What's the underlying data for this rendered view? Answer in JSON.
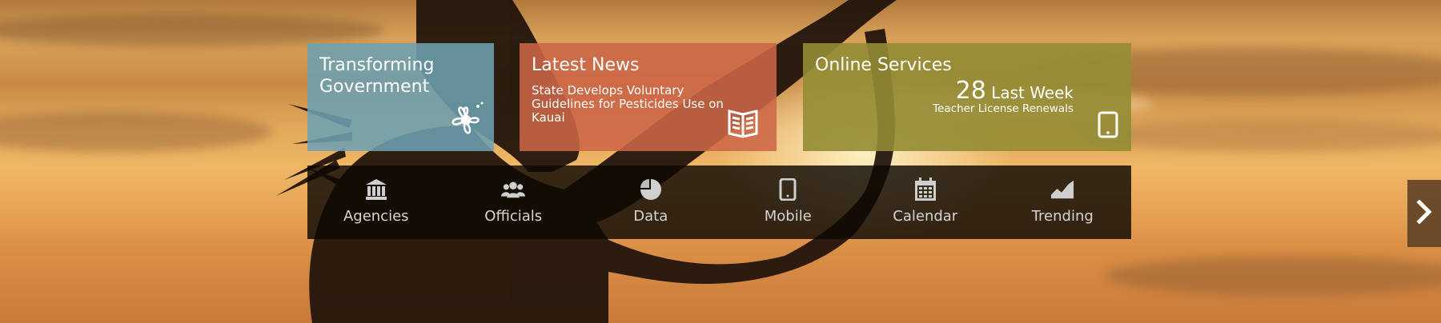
{
  "tiles": {
    "transforming": {
      "title": "Transforming Government",
      "bg": "#6ca0b0",
      "icon": "hibiscus-icon"
    },
    "news": {
      "title": "Latest News",
      "headline": "State Develops Voluntary Guidelines for Pesticides Use on Kauai",
      "bg": "#cd6648",
      "icon": "open-book-icon"
    },
    "services": {
      "title": "Online Services",
      "stat_number": "28",
      "stat_period": "Last Week",
      "stat_label": "Teacher License Renewals",
      "bg": "#938c34",
      "icon": "tablet-icon"
    }
  },
  "nav": {
    "items": [
      {
        "label": "Agencies",
        "icon": "building-icon"
      },
      {
        "label": "Officials",
        "icon": "people-icon"
      },
      {
        "label": "Data",
        "icon": "pie-chart-icon"
      },
      {
        "label": "Mobile",
        "icon": "tablet-icon"
      },
      {
        "label": "Calendar",
        "icon": "calendar-icon"
      },
      {
        "label": "Trending",
        "icon": "trending-icon"
      }
    ]
  },
  "slider": {
    "next_icon": "chevron-right-icon"
  }
}
